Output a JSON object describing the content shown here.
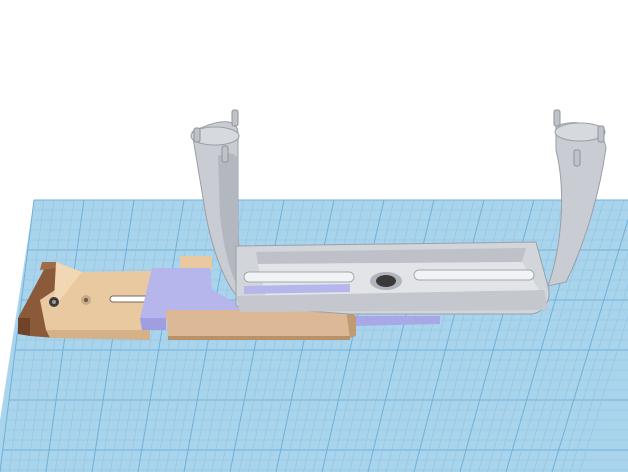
{
  "viewport": {
    "background": "#ffffff",
    "grid_color": "#a9d4ec",
    "grid_line_color": "#8fc4e4",
    "grid_major_line_color": "#6fb1da"
  },
  "model": {
    "parts": [
      {
        "name": "walnut-end-block",
        "color": "#8a5a3a"
      },
      {
        "name": "maple-slide-rail",
        "color": "#e8c9a0"
      },
      {
        "name": "violet-slide-plate",
        "color": "#b7b6ec"
      },
      {
        "name": "wood-front-plate",
        "color": "#dcb896"
      },
      {
        "name": "grey-cradle-frame",
        "color": "#c9ccd2"
      },
      {
        "name": "pins",
        "color": "#bfc3c9"
      },
      {
        "name": "center-hole",
        "color": "#3a3a3a"
      }
    ]
  }
}
